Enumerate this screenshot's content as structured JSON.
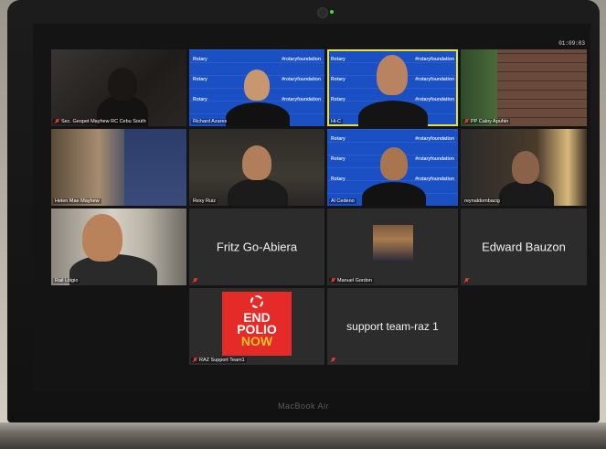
{
  "clock": "01:09:03",
  "device_brand": "MacBook Air",
  "rotary_text": "Rotary",
  "rotary_hashtag": "#rotaryfoundation",
  "tiles": [
    {
      "name": "Sec. Geopet Mayhew RC Cebu South",
      "muted": true
    },
    {
      "name": "Richard Azares",
      "muted": false
    },
    {
      "name": "Hi-C",
      "muted": false,
      "active": true
    },
    {
      "name": "PP Caloy Apuhin",
      "muted": true
    },
    {
      "name": "Helen Mae Mayhew",
      "muted": false
    },
    {
      "name": "Rexy Ruiz",
      "muted": false
    },
    {
      "name": "Al Cedeno",
      "muted": false
    },
    {
      "name": "reynaldombacig",
      "muted": false
    },
    {
      "name": "Rail Litigio",
      "muted": false
    },
    {
      "name": "Fritz Go-Abiera",
      "muted": true
    },
    {
      "name": "Manuel Gordon",
      "muted": true
    },
    {
      "name": "Edward Bauzon",
      "muted": true
    },
    {
      "name": "RAZ Support Team1",
      "muted": true
    },
    {
      "name": "support team-raz 1",
      "muted": true
    }
  ],
  "polio_card": {
    "line1": "END",
    "line2": "POLIO",
    "line3": "NOW"
  },
  "icons": {
    "mic_muted": "mic-muted-icon",
    "camera": "camera-icon",
    "rotary_wheel": "rotary-wheel-icon"
  },
  "colors": {
    "rotary_blue": "#1b4fc4",
    "active_border": "#e6e23a",
    "muted_red": "#e23a2e",
    "polio_red": "#e52b27"
  }
}
